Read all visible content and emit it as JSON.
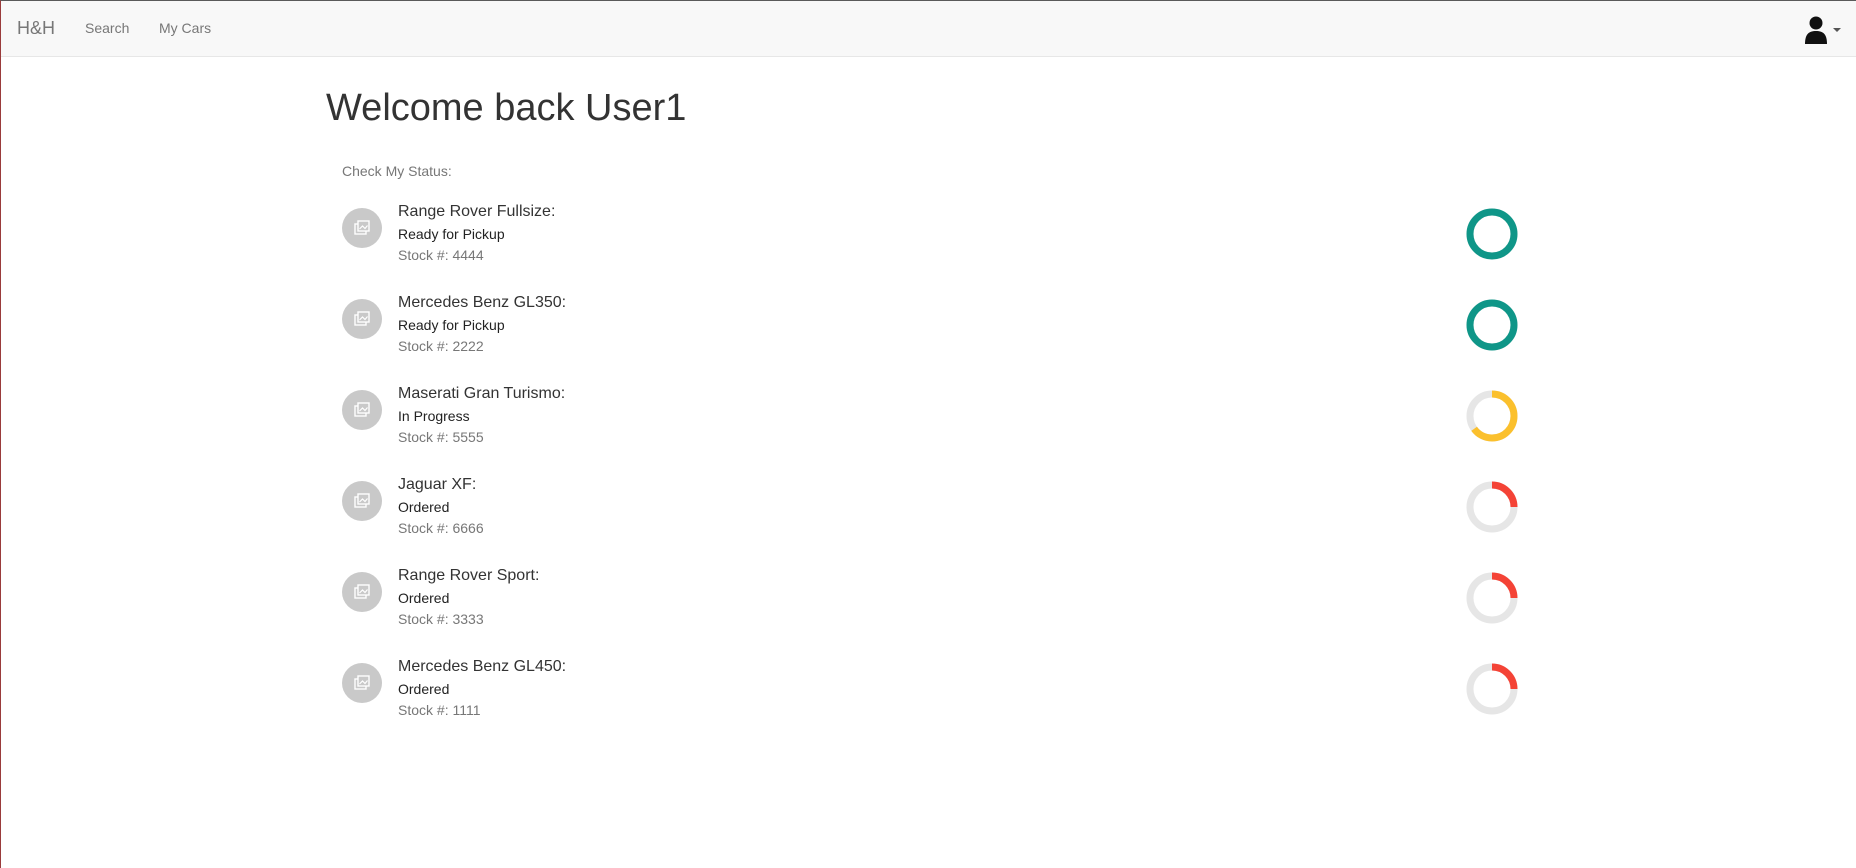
{
  "navbar": {
    "brand": "H&H",
    "links": [
      {
        "label": "Search"
      },
      {
        "label": "My Cars"
      }
    ]
  },
  "main": {
    "title": "Welcome back User1",
    "section_label": "Check My Status:",
    "stock_prefix": "Stock #:",
    "cars": [
      {
        "name": "Range Rover Fullsize:",
        "status": "Ready for Pickup",
        "stock": "Stock #: 4444",
        "progress": 1.0,
        "color": "#0f9688"
      },
      {
        "name": "Mercedes Benz GL350:",
        "status": "Ready for Pickup",
        "stock": "Stock #: 2222",
        "progress": 1.0,
        "color": "#0f9688"
      },
      {
        "name": "Maserati Gran Turismo:",
        "status": "In Progress",
        "stock": "Stock #: 5555",
        "progress": 0.65,
        "color": "#fbc02d"
      },
      {
        "name": "Jaguar XF:",
        "status": "Ordered",
        "stock": "Stock #: 6666",
        "progress": 0.25,
        "color": "#f44336"
      },
      {
        "name": "Range Rover Sport:",
        "status": "Ordered",
        "stock": "Stock #: 3333",
        "progress": 0.25,
        "color": "#f44336"
      },
      {
        "name": "Mercedes Benz GL450:",
        "status": "Ordered",
        "stock": "Stock #: 1111",
        "progress": 0.25,
        "color": "#f44336"
      }
    ]
  },
  "icons": {
    "user": "user-icon",
    "car_thumb": "image-icon"
  },
  "colors": {
    "ring_track": "#e6e6e6",
    "ready": "#0f9688",
    "in_progress": "#fbc02d",
    "ordered": "#f44336"
  }
}
